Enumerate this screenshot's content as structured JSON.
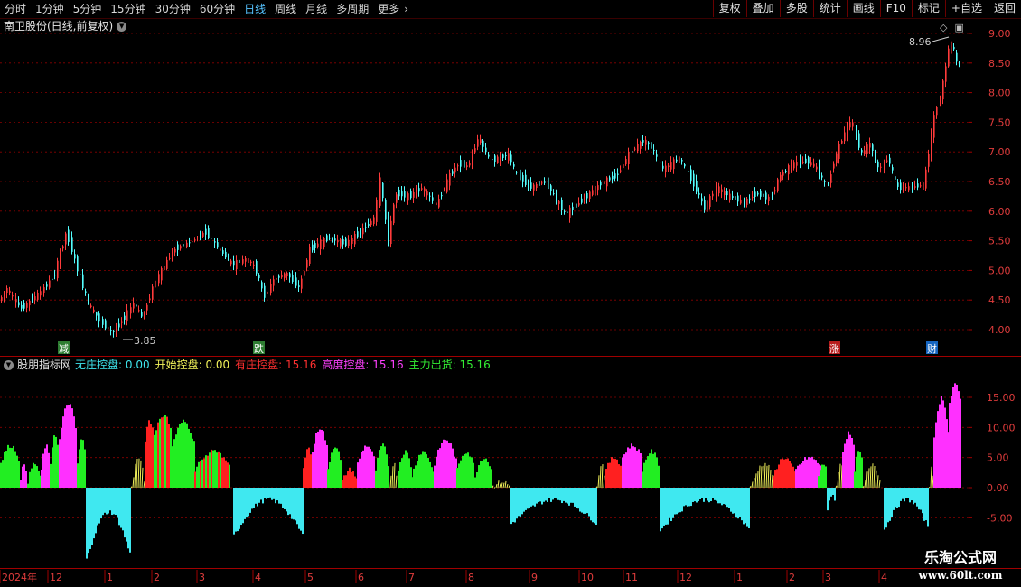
{
  "toolbar": {
    "periods": [
      "分时",
      "1分钟",
      "5分钟",
      "15分钟",
      "30分钟",
      "60分钟",
      "日线",
      "周线",
      "月线",
      "多周期",
      "更多"
    ],
    "active_period": "日线",
    "more_icon": "chevron-right-icon",
    "right_buttons": [
      "复权",
      "叠加",
      "多股",
      "统计",
      "画线",
      "F10",
      "标记",
      "+自选",
      "返回"
    ]
  },
  "stock": {
    "title": "南卫股份(日线,前复权)",
    "title_icon": "chevron-down-icon"
  },
  "price_axis": {
    "ticks": [
      "9.00",
      "8.50",
      "8.00",
      "7.50",
      "7.00",
      "6.50",
      "6.00",
      "5.50",
      "5.00",
      "4.50",
      "4.00"
    ]
  },
  "annotations": {
    "high_label": "8.96",
    "low_label": "3.85",
    "markers": [
      {
        "text": "减",
        "color": "#2e7d32"
      },
      {
        "text": "跌",
        "color": "#2e7d32"
      },
      {
        "text": "涨",
        "color": "#b71c1c"
      },
      {
        "text": "财",
        "color": "#1565c0"
      }
    ]
  },
  "indicator": {
    "name": "股朋指标网",
    "items": [
      {
        "label": "无庄控盘: 0.00",
        "color": "#3fe8f0"
      },
      {
        "label": "开始控盘: 0.00",
        "color": "#f2f25a"
      },
      {
        "label": "有庄控盘: 15.16",
        "color": "#ff3030"
      },
      {
        "label": "高度控盘: 15.16",
        "color": "#ff40ff"
      },
      {
        "label": "主力出货: 15.16",
        "color": "#33ee33"
      }
    ],
    "ticks": [
      "15.00",
      "10.00",
      "5.00",
      "0.00",
      "-5.00"
    ]
  },
  "date_axis": {
    "labels": [
      "2024年",
      "12",
      "1",
      "2",
      "3",
      "4",
      "5",
      "6",
      "7",
      "8",
      "9",
      "10",
      "11",
      "12",
      "1",
      "2",
      "3",
      "4"
    ]
  },
  "watermark": {
    "name": "乐淘公式网",
    "url": "www.60lt.com"
  },
  "colors": {
    "up": "#ff3b3b",
    "down": "#54ffff",
    "grid": "#8a0000",
    "border": "#a00000",
    "none_ctrl": "#3fe8f0",
    "start_ctrl": "#f2f25a",
    "has_ctrl": "#ff2020",
    "high_ctrl": "#ff30ff",
    "dump": "#22ee22"
  }
}
